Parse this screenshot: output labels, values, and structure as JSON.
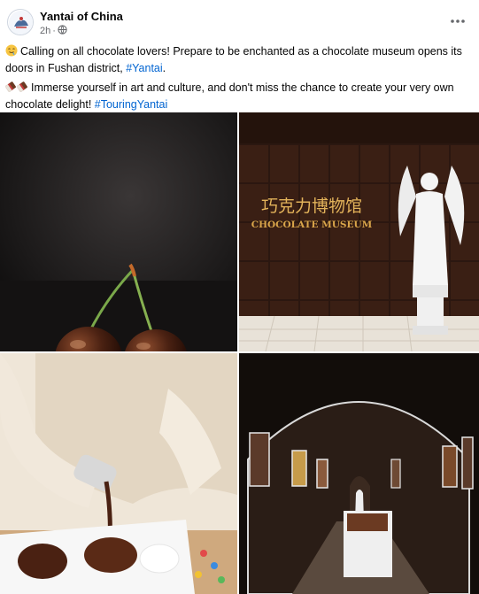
{
  "post": {
    "page_name": "Yantai of China",
    "timestamp": "2h",
    "privacy_icon": "globe-icon",
    "more_icon": "more-options-icon",
    "paragraph1": {
      "emoji": "drooling-face",
      "text": "Calling on all chocolate lovers! Prepare to be enchanted as a chocolate museum opens its doors in Fushan district,",
      "hashtag": "#Yantai",
      "trailing": "."
    },
    "paragraph2": {
      "emoji": "chocolate-bar",
      "text": "Immerse yourself in art and culture, and don't miss the chance to create your very own chocolate delight!",
      "hashtag": "#TouringYantai"
    }
  },
  "photos": [
    {
      "subject": "chocolate-cherries"
    },
    {
      "subject": "museum-entrance",
      "sign_cn": "巧克力博物馆",
      "sign_en": "CHOCOLATE MUSEUM"
    },
    {
      "subject": "pouring-chocolate-mold"
    },
    {
      "subject": "museum-gallery"
    }
  ],
  "colors": {
    "hashtag": "#0064d1",
    "meta": "#65676b",
    "text": "#050505"
  }
}
